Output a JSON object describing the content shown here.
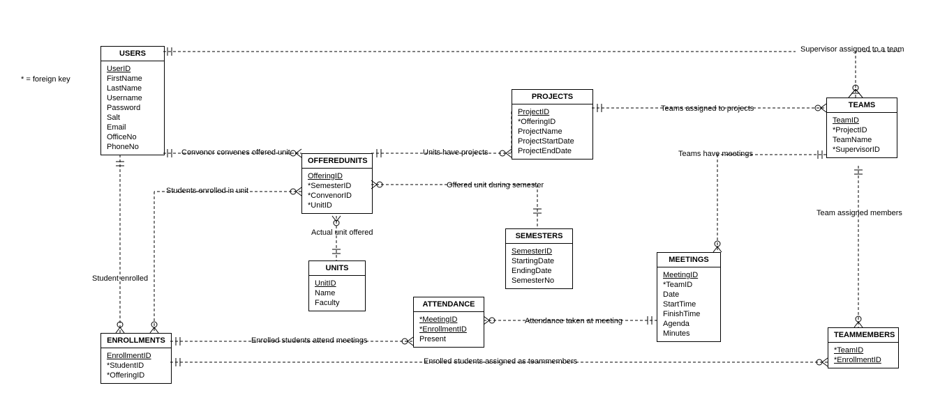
{
  "note_foreign_key": "* = foreign key",
  "entities": {
    "users": {
      "title": "USERS",
      "attrs": [
        {
          "t": "UserID",
          "pk": true
        },
        {
          "t": "FirstName"
        },
        {
          "t": "LastName"
        },
        {
          "t": "Username"
        },
        {
          "t": "Password"
        },
        {
          "t": "Salt"
        },
        {
          "t": "Email"
        },
        {
          "t": "OfficeNo"
        },
        {
          "t": "PhoneNo"
        }
      ]
    },
    "offeredunits": {
      "title": "OFFEREDUNITS",
      "attrs": [
        {
          "t": "OfferingID",
          "pk": true
        },
        {
          "t": "*SemesterID"
        },
        {
          "t": "*ConvenorID"
        },
        {
          "t": "*UnitID"
        }
      ]
    },
    "units": {
      "title": "UNITS",
      "attrs": [
        {
          "t": "UnitID",
          "pk": true
        },
        {
          "t": "Name"
        },
        {
          "t": "Faculty"
        }
      ]
    },
    "projects": {
      "title": "PROJECTS",
      "attrs": [
        {
          "t": "ProjectID",
          "pk": true
        },
        {
          "t": "*OfferingID"
        },
        {
          "t": "ProjectName"
        },
        {
          "t": "ProjectStartDate"
        },
        {
          "t": "ProjectEndDate"
        }
      ]
    },
    "teams": {
      "title": "TEAMS",
      "attrs": [
        {
          "t": "TeamID",
          "pk": true
        },
        {
          "t": "*ProjectID"
        },
        {
          "t": "TeamName"
        },
        {
          "t": "*SupervisorID"
        }
      ]
    },
    "semesters": {
      "title": "SEMESTERS",
      "attrs": [
        {
          "t": "SemesterID",
          "pk": true
        },
        {
          "t": "StartingDate"
        },
        {
          "t": "EndingDate"
        },
        {
          "t": "SemesterNo"
        }
      ]
    },
    "meetings": {
      "title": "MEETINGS",
      "attrs": [
        {
          "t": "MeetingID",
          "pk": true
        },
        {
          "t": "*TeamID"
        },
        {
          "t": "Date"
        },
        {
          "t": "StartTime"
        },
        {
          "t": "FinishTime"
        },
        {
          "t": "Agenda"
        },
        {
          "t": "Minutes"
        }
      ]
    },
    "attendance": {
      "title": "ATTENDANCE",
      "attrs": [
        {
          "t": "*MeetingID",
          "pk": true
        },
        {
          "t": "*EnrollmentID",
          "pk": true
        },
        {
          "t": "Present"
        }
      ]
    },
    "enrollments": {
      "title": "ENROLLMENTS",
      "attrs": [
        {
          "t": "EnrollmentID",
          "pk": true
        },
        {
          "t": "*StudentID"
        },
        {
          "t": "*OfferingID"
        }
      ]
    },
    "teammembers": {
      "title": "TEAMMEMBERS",
      "attrs": [
        {
          "t": "*TeamID",
          "pk": true
        },
        {
          "t": "*EnrollmentID",
          "pk": true
        }
      ]
    }
  },
  "labels": {
    "supervisor": "Supervisor assigned to a team",
    "teams_projects": "Teams assigned to projects",
    "teams_meetings": "Teams have meetings",
    "team_members": "Team assigned members",
    "convenor": "Convenor convenes offered unit",
    "units_projects": "Units have projects",
    "offered_semester": "Offered unit during semester",
    "actual_unit": "Actual unit offered",
    "students_unit": "Students enrolled in unit",
    "student_enrolled": "Student enrolled",
    "enrolled_attend": "Enrolled students attend meetings",
    "attendance_meeting": "Attendance taken at meeting",
    "enrolled_teammembers": "Enrolled students assigned as teammembers"
  }
}
